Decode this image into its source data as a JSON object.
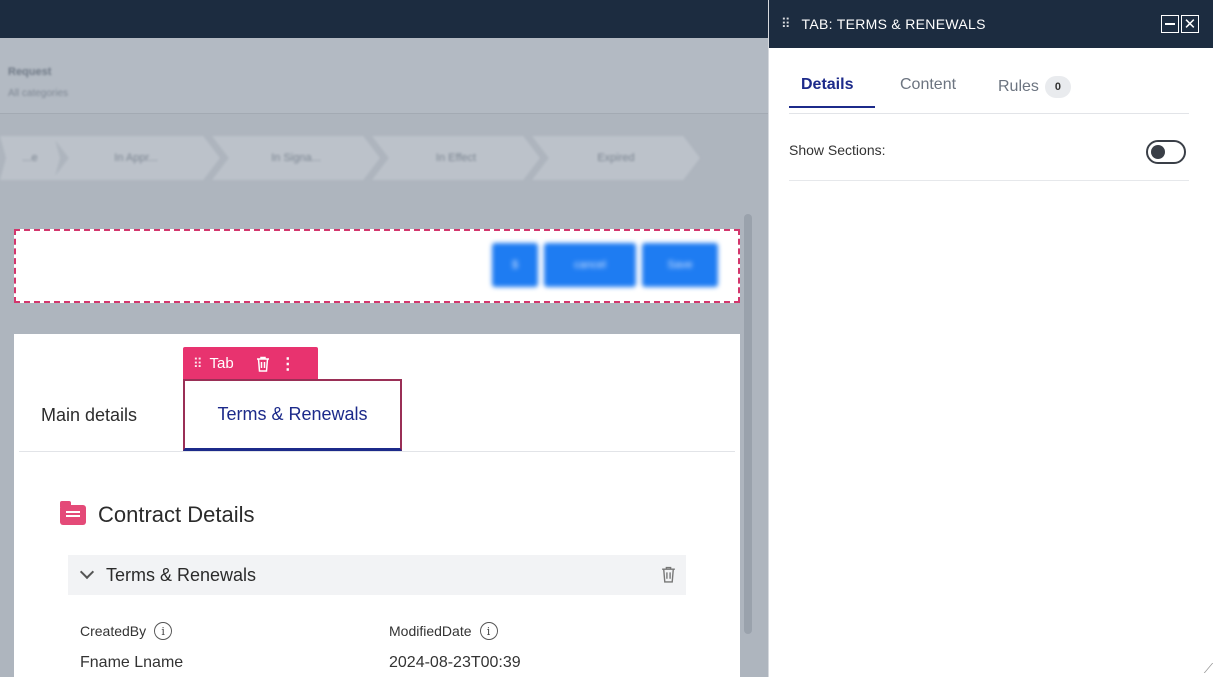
{
  "background_app": {
    "title": "Request",
    "subtitle": "All categories",
    "stages": [
      "...e",
      "In Appr...",
      "In Signa...",
      "In Effect",
      "Expired"
    ],
    "buttons": [
      "$",
      "cancel",
      "Save"
    ]
  },
  "card": {
    "tab_toolbar_label": "Tab",
    "tabs": [
      "Main details",
      "Terms & Renewals"
    ],
    "section_title": "Contract Details",
    "accordion_title": "Terms & Renewals",
    "fields": [
      {
        "label": "CreatedBy",
        "value": "Fname Lname"
      },
      {
        "label": "ModifiedDate",
        "value": "2024-08-23T00:39"
      }
    ]
  },
  "panel": {
    "title": "TAB:  TERMS & RENEWALS",
    "tabs": [
      {
        "label": "Details"
      },
      {
        "label": "Content"
      },
      {
        "label": "Rules",
        "badge": "0"
      }
    ],
    "show_sections_label": "Show Sections:",
    "show_sections_on": false
  },
  "colors": {
    "accent_pink": "#e8336f",
    "navy": "#1c2c40",
    "active_blue": "#1c2a8a"
  }
}
